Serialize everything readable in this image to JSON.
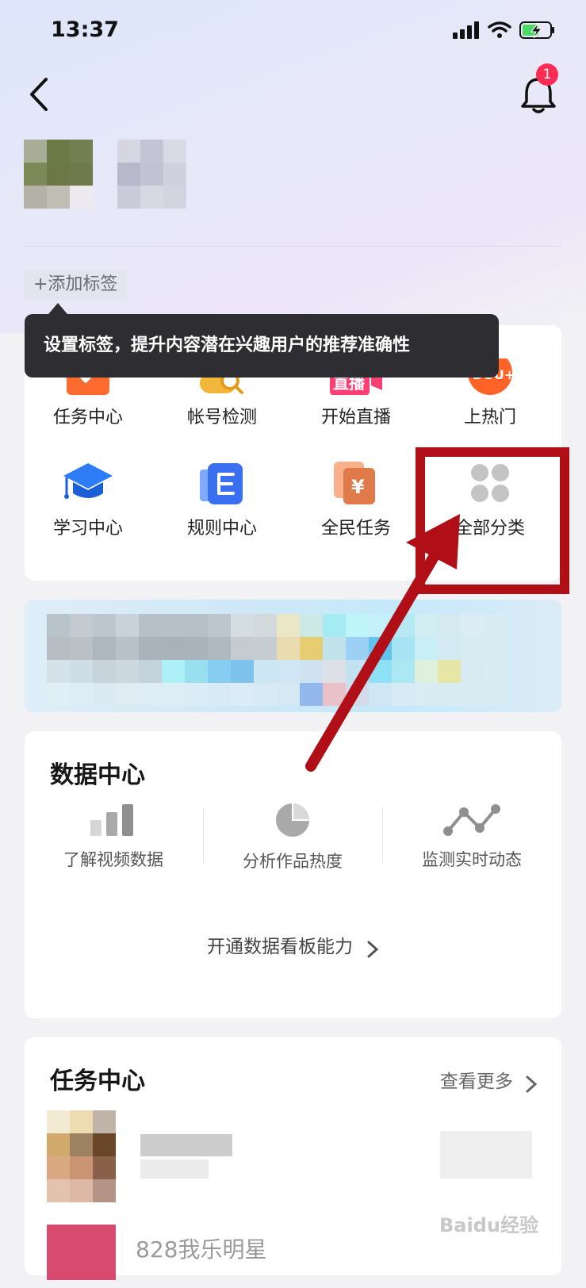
{
  "status_bar": {
    "time": "13:37"
  },
  "header": {
    "notification_count": "1"
  },
  "profile": {
    "add_tag_label": "+添加标签"
  },
  "tooltip": {
    "text": "设置标签，提升内容潜在兴趣用户的推荐准确性"
  },
  "tools": {
    "row1": [
      {
        "label": "任务中心",
        "icon": "task-check-icon"
      },
      {
        "label": "帐号检测",
        "icon": "account-scan-icon"
      },
      {
        "label": "开始直播",
        "icon": "live-icon"
      },
      {
        "label": "上热门",
        "icon": "dou-plus-icon"
      }
    ],
    "row2": [
      {
        "label": "学习中心",
        "icon": "graduation-cap-icon"
      },
      {
        "label": "规则中心",
        "icon": "rule-book-icon"
      },
      {
        "label": "全民任务",
        "icon": "yuan-card-icon"
      },
      {
        "label": "全部分类",
        "icon": "grid-dots-icon"
      }
    ]
  },
  "data_center": {
    "title": "数据中心",
    "items": [
      {
        "label": "了解视频数据",
        "icon": "bar-chart-icon"
      },
      {
        "label": "分析作品热度",
        "icon": "pie-chart-icon"
      },
      {
        "label": "监测实时动态",
        "icon": "line-trend-icon"
      }
    ],
    "open_link": "开通数据看板能力"
  },
  "task_center": {
    "title": "任务中心",
    "more_label": "查看更多",
    "items_partial": [
      "828我乐明星"
    ]
  },
  "watermark": "Baidu经验",
  "colors": {
    "highlight_red": "#b00f17",
    "badge_red": "#fe2c55",
    "orange": "#fe6c2e"
  }
}
